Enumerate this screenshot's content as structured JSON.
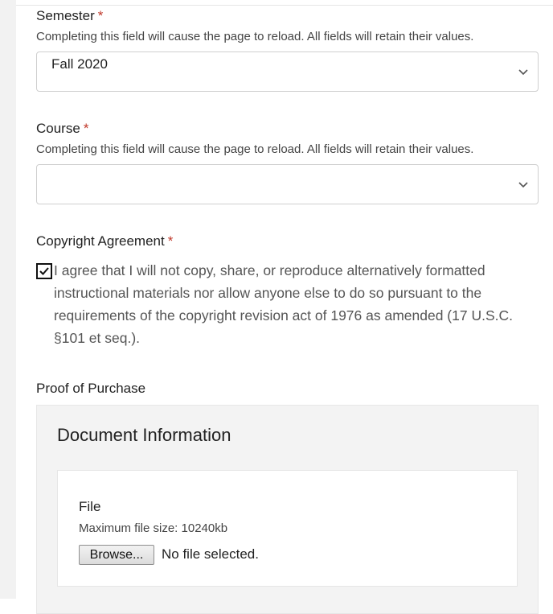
{
  "semester": {
    "label": "Semester",
    "required_mark": "*",
    "help": "Completing this field will cause the page to reload. All fields will retain their values.",
    "value": "Fall 2020"
  },
  "course": {
    "label": "Course",
    "required_mark": "*",
    "help": "Completing this field will cause the page to reload. All fields will retain their values.",
    "value": ""
  },
  "copyright": {
    "label": "Copyright Agreement",
    "required_mark": "*",
    "checked": true,
    "text": "I agree that I will not copy, share, or reproduce alternatively formatted instructional materials nor allow anyone else to do so pursuant to the requirements of the copyright revision act of 1976 as amended (17 U.S.C. §101 et seq.)."
  },
  "proof": {
    "label": "Proof of Purchase",
    "panel_title": "Document Information",
    "file_label": "File",
    "file_help": "Maximum file size: 10240kb",
    "browse_label": "Browse...",
    "file_status": "No file selected."
  },
  "colors": {
    "required": "#c0392b",
    "panel_bg": "#f3f3f3"
  }
}
